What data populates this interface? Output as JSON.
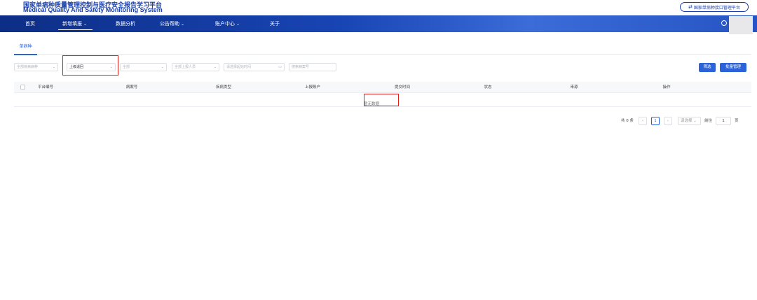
{
  "header": {
    "title_cn": "国家单病种质量管理控制与医疗安全报告学习平台",
    "title_en": "Medical  Quality And Safety Monitoring System",
    "interface_button": "国家单病种接口管理平台"
  },
  "nav": {
    "items": [
      {
        "label": "首页"
      },
      {
        "label": "新增填报",
        "caret": "⌄"
      },
      {
        "label": "数据分析"
      },
      {
        "label": "公告帮助",
        "caret": "⌄"
      },
      {
        "label": "账户中心",
        "caret": "⌄"
      },
      {
        "label": "关于"
      }
    ]
  },
  "tabs": [
    {
      "label": "单病种"
    }
  ],
  "filters": {
    "disease": "全部疾病病种",
    "report_status": "上级退回",
    "all": "全部",
    "reporter": "全部上报人员",
    "date_placeholder": "请选择起始时间",
    "case_placeholder": "搜索病案号"
  },
  "buttons": {
    "filter": "筛选",
    "batch": "批量管理"
  },
  "table": {
    "headers": [
      "平台编号",
      "病案号",
      "疾病类型",
      "上报账户",
      "提交时间",
      "状态",
      "来源",
      "操作"
    ],
    "empty_text": "暂无数据"
  },
  "pagination": {
    "total": "共 0 条",
    "prev": "‹",
    "current_page": "1",
    "next": "›",
    "page_size_placeholder": "请选择",
    "goto_label": "前往",
    "goto_value": "1",
    "page_suffix": "页"
  },
  "colors": {
    "brand_blue": "#1a3fa8",
    "accent": "#2c63d8",
    "highlight_red": "#e0201c"
  }
}
